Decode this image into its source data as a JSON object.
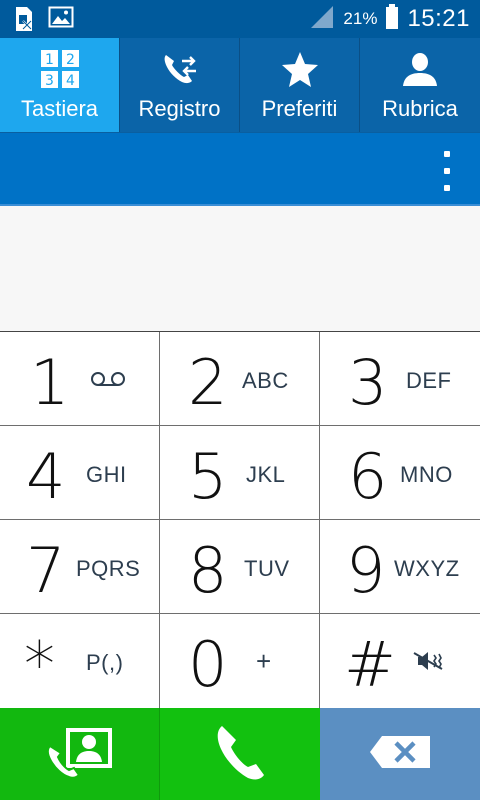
{
  "status_bar": {
    "icons": [
      "sim-card-x-icon",
      "image-icon"
    ],
    "signal_icon": "signal-icon",
    "battery_percent": "21%",
    "battery_icon": "battery-icon",
    "time": "15:21"
  },
  "tabs": [
    {
      "label": "Tastiera",
      "icon": "keypad-icon",
      "active": true
    },
    {
      "label": "Registro",
      "icon": "call-log-icon",
      "active": false
    },
    {
      "label": "Preferiti",
      "icon": "star-icon",
      "active": false
    },
    {
      "label": "Rubrica",
      "icon": "person-icon",
      "active": false
    }
  ],
  "action_bar": {
    "more_icon": "more-vertical-icon"
  },
  "number_display": {
    "value": ""
  },
  "keypad": {
    "keys": [
      {
        "digit": "1",
        "sub": "",
        "sub_icon": "voicemail-icon"
      },
      {
        "digit": "2",
        "sub": "ABC"
      },
      {
        "digit": "3",
        "sub": "DEF"
      },
      {
        "digit": "4",
        "sub": "GHI"
      },
      {
        "digit": "5",
        "sub": "JKL"
      },
      {
        "digit": "6",
        "sub": "MNO"
      },
      {
        "digit": "7",
        "sub": "PQRS"
      },
      {
        "digit": "8",
        "sub": "TUV"
      },
      {
        "digit": "9",
        "sub": "WXYZ"
      },
      {
        "digit": "*",
        "sub": "P(,)"
      },
      {
        "digit": "0",
        "sub": "+"
      },
      {
        "digit": "#",
        "sub": "",
        "sub_icon": "mute-icon"
      }
    ]
  },
  "bottom_bar": {
    "contacts_icon": "add-contact-icon",
    "call_icon": "phone-icon",
    "delete_icon": "backspace-icon"
  },
  "colors": {
    "status_bar": "#005a9c",
    "tabs_bg": "#0b64a8",
    "tab_active": "#1ea7ee",
    "action_bar": "#0072c6",
    "call_green": "#12c10f",
    "delete_blue": "#5b8fc2"
  }
}
